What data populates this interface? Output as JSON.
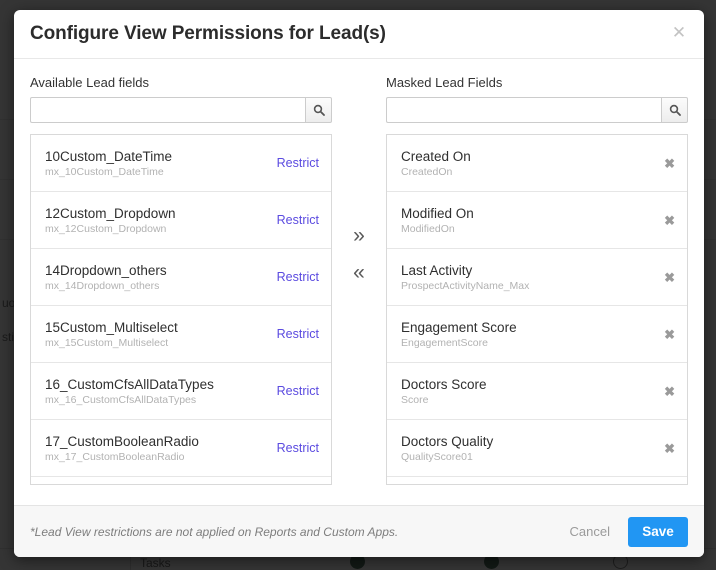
{
  "background": {
    "tasks_label": "Tasks",
    "clipped_text_left": [
      "uo",
      "sti"
    ]
  },
  "modal": {
    "title": "Configure View Permissions for Lead(s)",
    "close_icon": "close-icon"
  },
  "left_panel": {
    "label": "Available Lead fields",
    "search": {
      "value": "",
      "placeholder": "",
      "icon": "search-icon"
    },
    "action_label": "Restrict",
    "items": [
      {
        "title": "10Custom_DateTime",
        "schema": "mx_10Custom_DateTime"
      },
      {
        "title": "12Custom_Dropdown",
        "schema": "mx_12Custom_Dropdown"
      },
      {
        "title": "14Dropdown_others",
        "schema": "mx_14Dropdown_others"
      },
      {
        "title": "15Custom_Multiselect",
        "schema": "mx_15Custom_Multiselect"
      },
      {
        "title": "16_CustomCfsAllDataTypes",
        "schema": "mx_16_CustomCfsAllDataTypes"
      },
      {
        "title": "17_CustomBooleanRadio",
        "schema": "mx_17_CustomBooleanRadio"
      }
    ]
  },
  "transfer": {
    "add_icon": "»",
    "remove_icon": "«"
  },
  "right_panel": {
    "label": "Masked Lead Fields",
    "search": {
      "value": "",
      "placeholder": "",
      "icon": "search-icon"
    },
    "remove_icon": "✖",
    "items": [
      {
        "title": "Created On",
        "schema": "CreatedOn"
      },
      {
        "title": "Modified On",
        "schema": "ModifiedOn"
      },
      {
        "title": "Last Activity",
        "schema": "ProspectActivityName_Max"
      },
      {
        "title": "Engagement Score",
        "schema": "EngagementScore"
      },
      {
        "title": "Doctors Score",
        "schema": "Score"
      },
      {
        "title": "Doctors Quality",
        "schema": "QualityScore01"
      }
    ]
  },
  "footer": {
    "note": "*Lead View restrictions are not applied on Reports and Custom Apps.",
    "cancel_label": "Cancel",
    "save_label": "Save"
  },
  "colors": {
    "accent_link": "#5b4be0",
    "primary_button": "#2196f3",
    "muted_text": "#b2b2b2"
  }
}
